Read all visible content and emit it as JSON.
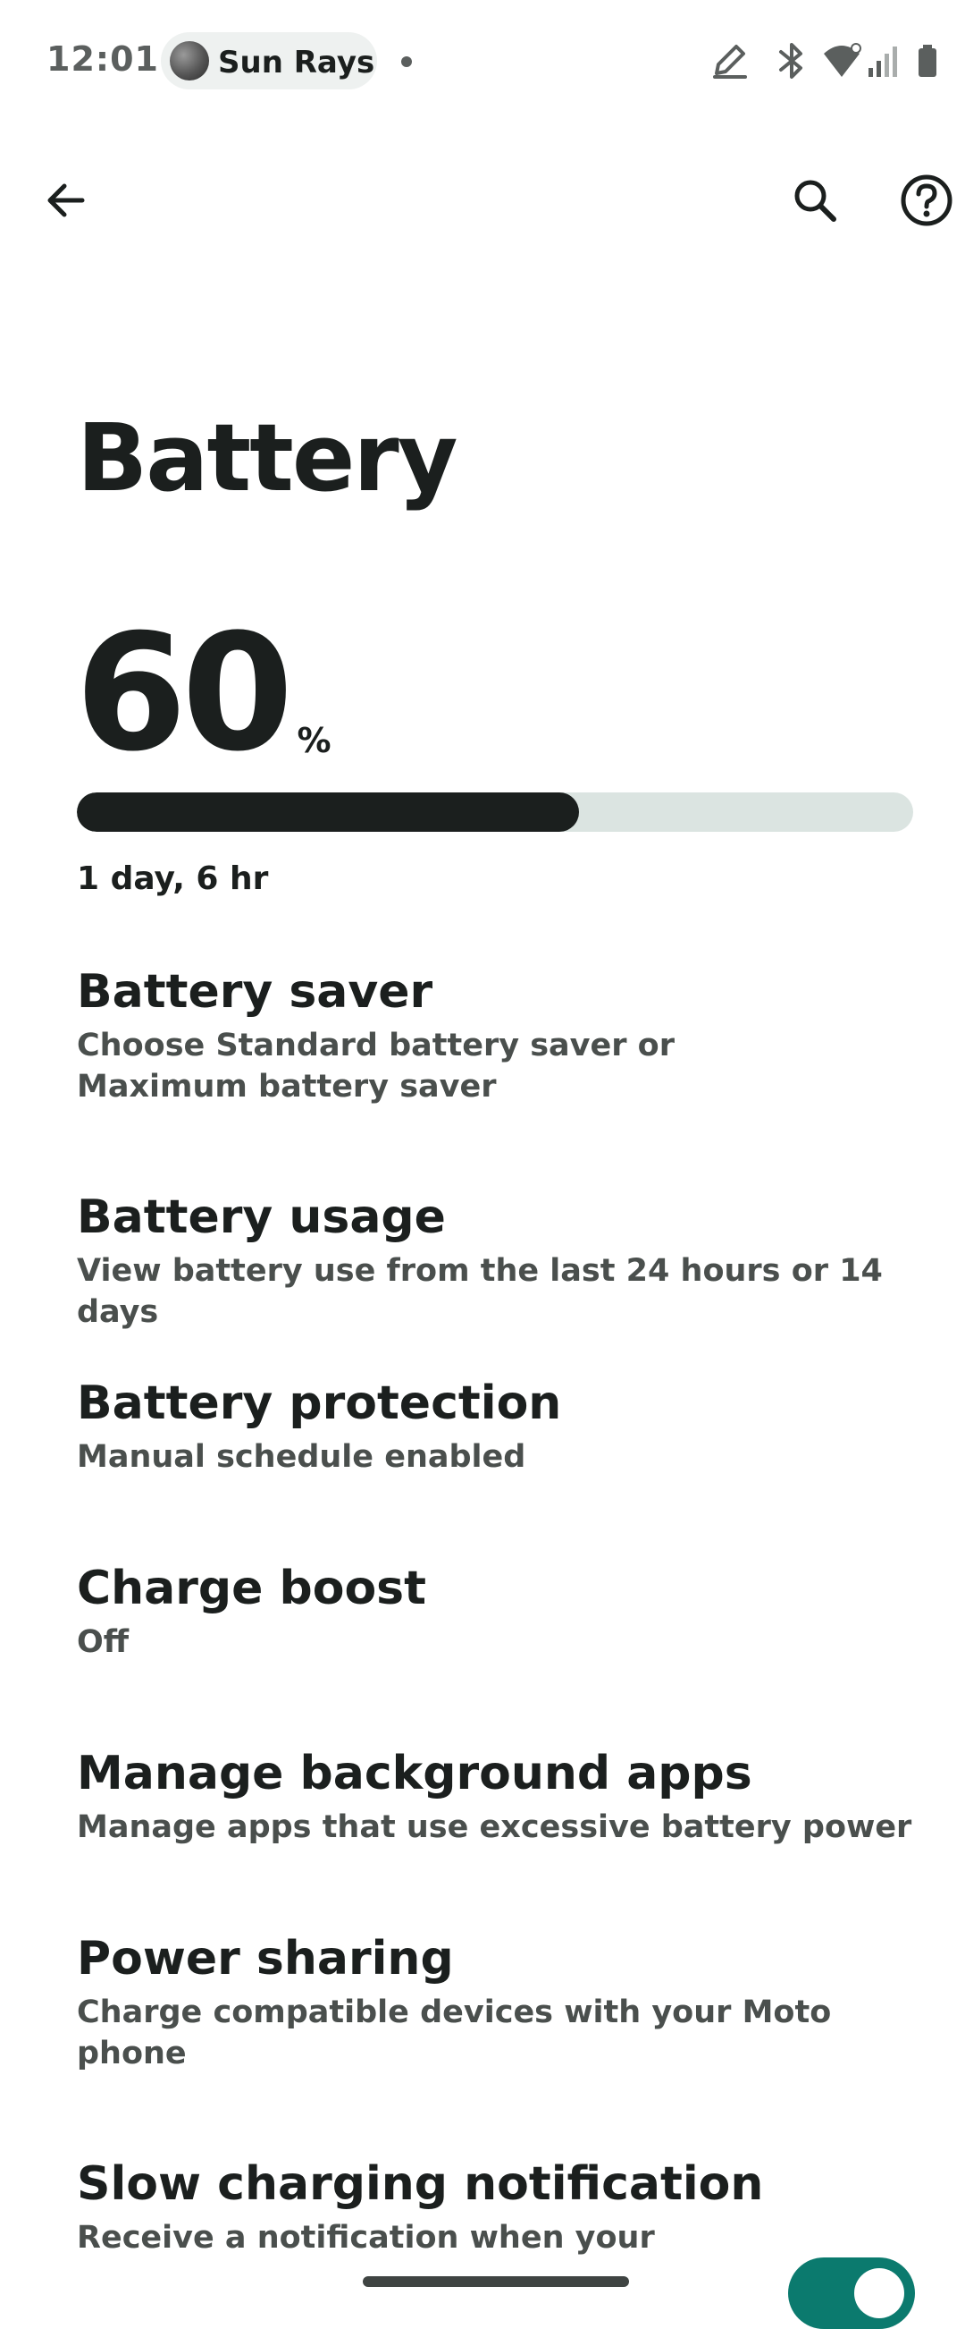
{
  "status_bar": {
    "time": "12:01",
    "media_title": "Sun Rays",
    "icons": [
      "edit-pen-icon",
      "bluetooth-icon",
      "wifi-icon",
      "signal-icon",
      "battery-icon"
    ]
  },
  "app_bar": {
    "icons": [
      "back-arrow-icon",
      "search-icon",
      "help-icon"
    ]
  },
  "header": {
    "title": "Battery",
    "level_value": "60",
    "level_unit": "%",
    "level_fraction": 0.6,
    "estimate": "1 day, 6 hr"
  },
  "settings": {
    "items": [
      {
        "title": "Battery saver",
        "summary": "Choose Standard battery saver or Maximum battery saver"
      },
      {
        "title": "Battery usage",
        "summary": "View battery use from the last 24 hours or 14 days"
      },
      {
        "title": "Battery protection",
        "summary": "Manual schedule enabled"
      },
      {
        "title": "Charge boost",
        "summary": "Off"
      },
      {
        "title": "Manage background apps",
        "summary": "Manage apps that use excessive battery power"
      },
      {
        "title": "Power sharing",
        "summary": "Charge compatible devices with your Moto phone"
      },
      {
        "title": "Slow charging notification",
        "summary": "Receive a notification when your",
        "toggle_on": true
      }
    ]
  },
  "colors": {
    "text_primary": "#1b1f1e",
    "text_secondary": "#4a4f4d",
    "bar_track": "#dbe4e1",
    "toggle_on": "#0b7a6e"
  }
}
